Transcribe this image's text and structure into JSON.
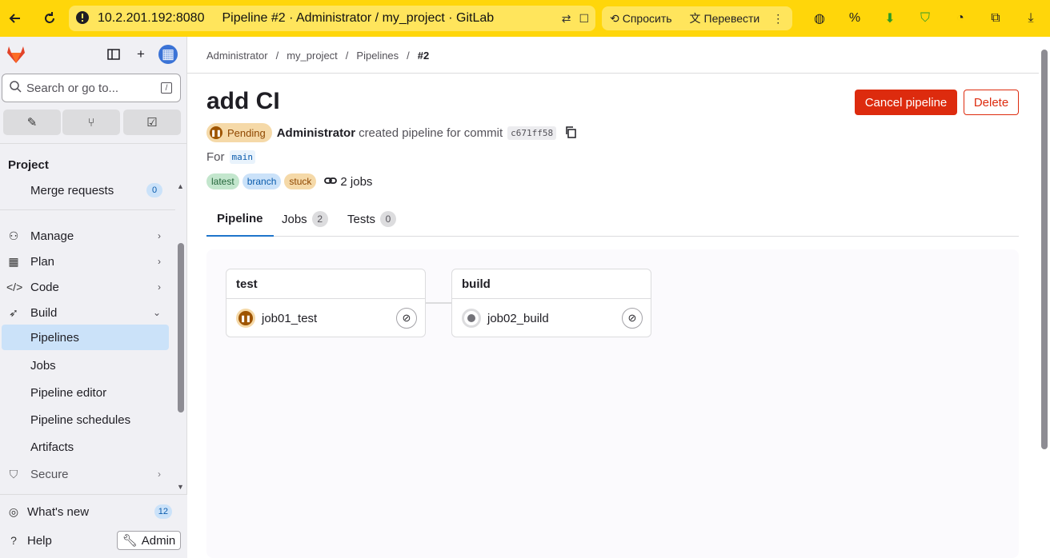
{
  "browser": {
    "url": "10.2.201.192:8080",
    "page_title": "Pipeline #2 · Administrator / my_project · GitLab",
    "ask_label": "Спросить",
    "translate_label": "Перевести"
  },
  "sidebar": {
    "search_placeholder": "Search or go to...",
    "search_shortcut": "/",
    "section_title": "Project",
    "items": [
      {
        "label": "Merge requests",
        "badge": "0"
      },
      {
        "label": "Manage"
      },
      {
        "label": "Plan"
      },
      {
        "label": "Code"
      },
      {
        "label": "Build"
      },
      {
        "label": "Pipelines"
      },
      {
        "label": "Jobs"
      },
      {
        "label": "Pipeline editor"
      },
      {
        "label": "Pipeline schedules"
      },
      {
        "label": "Artifacts"
      },
      {
        "label": "Secure"
      }
    ],
    "whats_new_label": "What's new",
    "whats_new_count": "12",
    "help_label": "Help",
    "admin_label": "Admin"
  },
  "breadcrumb": [
    "Administrator",
    "my_project",
    "Pipelines",
    "#2"
  ],
  "pipeline": {
    "title": "add CI",
    "status": "Pending",
    "author": "Administrator",
    "action_text": "created pipeline for commit",
    "commit": "c671ff58",
    "for_label": "For",
    "ref": "main",
    "tags": [
      "latest",
      "branch",
      "stuck"
    ],
    "jobs_summary": "2 jobs",
    "cancel_label": "Cancel pipeline",
    "delete_label": "Delete"
  },
  "tabs": [
    {
      "label": "Pipeline",
      "count": ""
    },
    {
      "label": "Jobs",
      "count": "2"
    },
    {
      "label": "Tests",
      "count": "0"
    }
  ],
  "stages": [
    {
      "name": "test",
      "job": "job01_test",
      "status": "pending"
    },
    {
      "name": "build",
      "job": "job02_build",
      "status": "created"
    }
  ],
  "colors": {
    "browser_bar": "#ffd60a",
    "danger": "#dd2b0e",
    "active_nav": "#cbe2f9",
    "pending": "#9e5400"
  }
}
